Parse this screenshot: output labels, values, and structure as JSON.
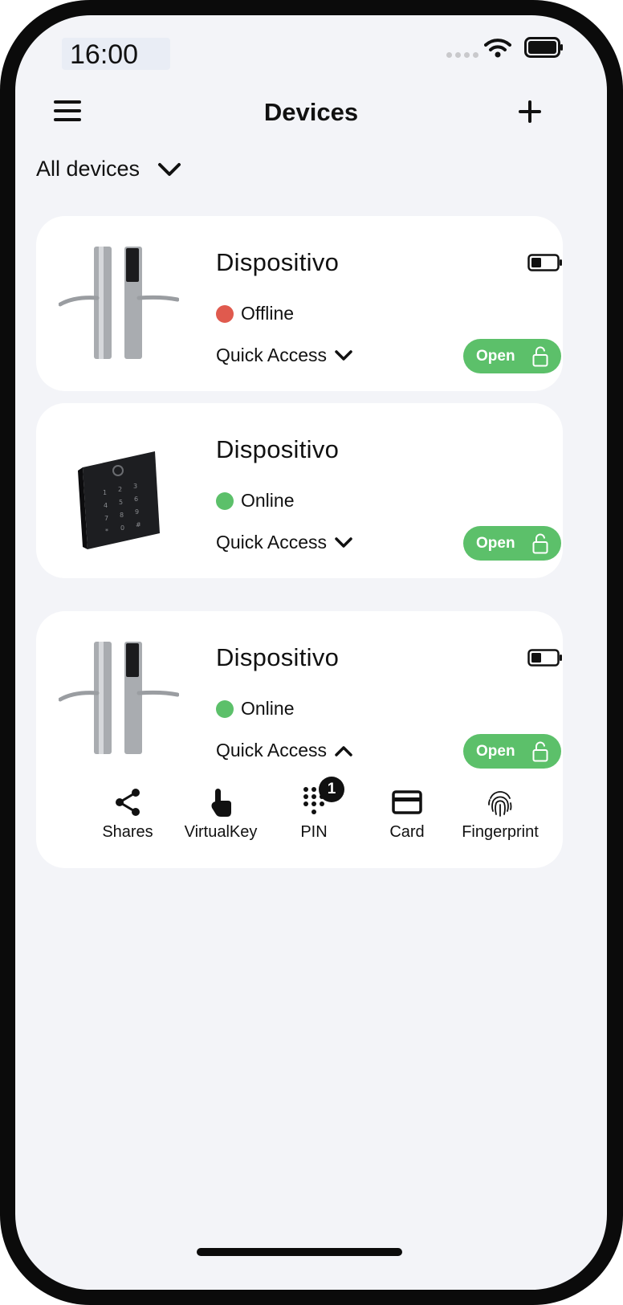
{
  "status_bar": {
    "time": "16:00"
  },
  "header": {
    "title": "Devices"
  },
  "filter": {
    "label": "All devices"
  },
  "devices": [
    {
      "name": "Dispositivo",
      "status": "Offline",
      "status_color": "#e05a4e",
      "quick_access": "Quick Access",
      "open_label": "Open",
      "image": "lever-handle-lock",
      "battery": true,
      "expanded": false
    },
    {
      "name": "Dispositivo",
      "status": "Online",
      "status_color": "#5cc06a",
      "quick_access": "Quick Access",
      "open_label": "Open",
      "image": "keypad-reader",
      "battery": false,
      "expanded": false
    },
    {
      "name": "Dispositivo",
      "status": "Online",
      "status_color": "#5cc06a",
      "quick_access": "Quick Access",
      "open_label": "Open",
      "image": "lever-handle-lock",
      "battery": true,
      "expanded": true
    }
  ],
  "quick_actions": [
    {
      "label": "Shares",
      "icon": "share-icon"
    },
    {
      "label": "VirtualKey",
      "icon": "touch-icon"
    },
    {
      "label": "PIN",
      "icon": "keypad-icon",
      "badge": "1"
    },
    {
      "label": "Card",
      "icon": "card-icon"
    },
    {
      "label": "Fingerprint",
      "icon": "fingerprint-icon"
    }
  ],
  "colors": {
    "accent_green": "#5cc06a",
    "offline_red": "#e05a4e",
    "background": "#f3f4f8"
  }
}
